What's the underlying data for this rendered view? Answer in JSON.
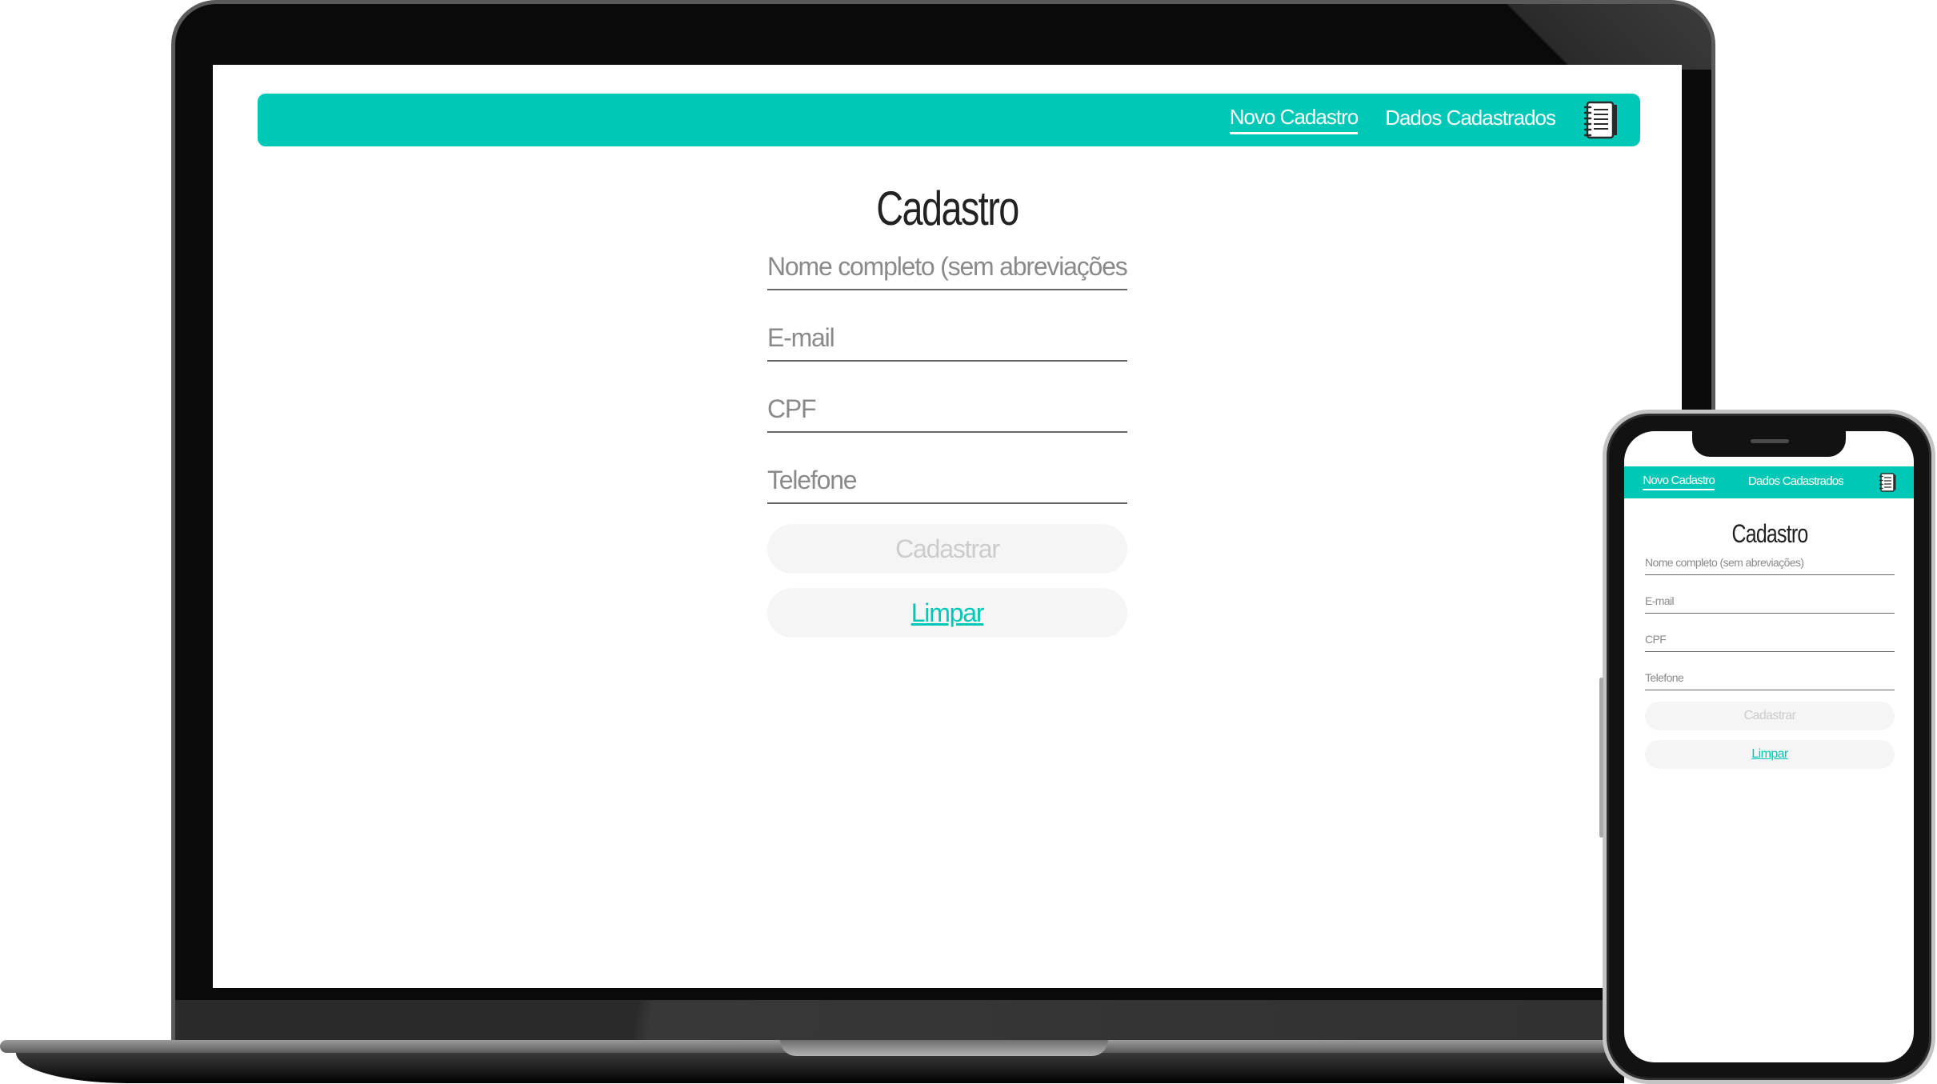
{
  "app": {
    "nav": {
      "new_label": "Novo Cadastro",
      "data_label": "Dados Cadastrados",
      "icon": "notebook-icon"
    },
    "form": {
      "title": "Cadastro",
      "name_placeholder": "Nome completo (sem abreviações)",
      "email_placeholder": "E-mail",
      "cpf_placeholder": "CPF",
      "phone_placeholder": "Telefone",
      "submit_label": "Cadastrar",
      "clear_label": "Limpar"
    }
  },
  "colors": {
    "accent": "#00c8b6",
    "button_bg": "#f5f5f5",
    "field_border": "#666666"
  }
}
